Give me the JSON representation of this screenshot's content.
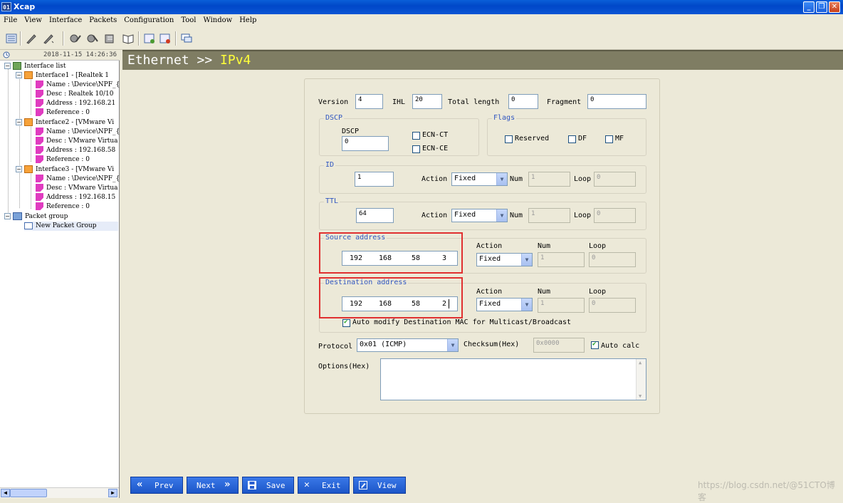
{
  "window": {
    "title": "Xcap",
    "icon_text": "01"
  },
  "menu": [
    "File",
    "View",
    "Interface",
    "Packets",
    "Configuration",
    "Tool",
    "Window",
    "Help"
  ],
  "left": {
    "timestamp": "2018-11-15 14:26:36",
    "tree": {
      "interface_list": "Interface list",
      "interfaces": [
        {
          "label": "Interface1 - [Realtek 1",
          "name": "Name : \\Device\\NPF_{",
          "desc": "Desc : Realtek 10/10",
          "address": "Address : 192.168.21",
          "reference": "Reference : 0"
        },
        {
          "label": "Interface2 - [VMware Vi",
          "name": "Name : \\Device\\NPF_{",
          "desc": "Desc : VMware Virtua",
          "address": "Address : 192.168.58",
          "reference": "Reference : 0"
        },
        {
          "label": "Interface3 - [VMware Vi",
          "name": "Name : \\Device\\NPF_{",
          "desc": "Desc : VMware Virtua",
          "address": "Address : 192.168.15",
          "reference": "Reference : 0"
        }
      ],
      "packet_group": "Packet group",
      "new_packet_group": "New Packet Group"
    }
  },
  "header": {
    "prefix": "Ethernet >> ",
    "current": "IPv4"
  },
  "form": {
    "version_label": "Version",
    "version": "4",
    "ihl_label": "IHL",
    "ihl": "20",
    "total_length_label": "Total length",
    "total_length": "0",
    "fragment_label": "Fragment",
    "fragment": "0",
    "dscp_group": "DSCP",
    "dscp_label": "DSCP",
    "dscp": "0",
    "ecn_ct": "ECN-CT",
    "ecn_ce": "ECN-CE",
    "flags_group": "Flags",
    "flag_reserved": "Reserved",
    "flag_df": "DF",
    "flag_mf": "MF",
    "id_group": "ID",
    "id": "1",
    "ttl_group": "TTL",
    "ttl": "64",
    "action_label": "Action",
    "num_label": "Num",
    "loop_label": "Loop",
    "fixed": "Fixed",
    "num_value": "1",
    "loop_value": "0",
    "source_group": "Source address",
    "source_ip": [
      "192",
      "168",
      "58",
      "3"
    ],
    "dest_group": "Destination address",
    "dest_ip": [
      "192",
      "168",
      "58",
      "2"
    ],
    "auto_mac": "Auto modify Destination MAC for Multicast/Broadcast",
    "protocol_label": "Protocol",
    "protocol": "0x01 (ICMP)",
    "checksum_label": "Checksum(Hex)",
    "checksum": "0x0000",
    "auto_calc": "Auto calc",
    "options_label": "Options(Hex)"
  },
  "nav": {
    "prev": "Prev",
    "next": "Next",
    "save": "Save",
    "exit": "Exit",
    "view": "View"
  },
  "watermark": "https://blog.csdn.net/@51CTO博客"
}
